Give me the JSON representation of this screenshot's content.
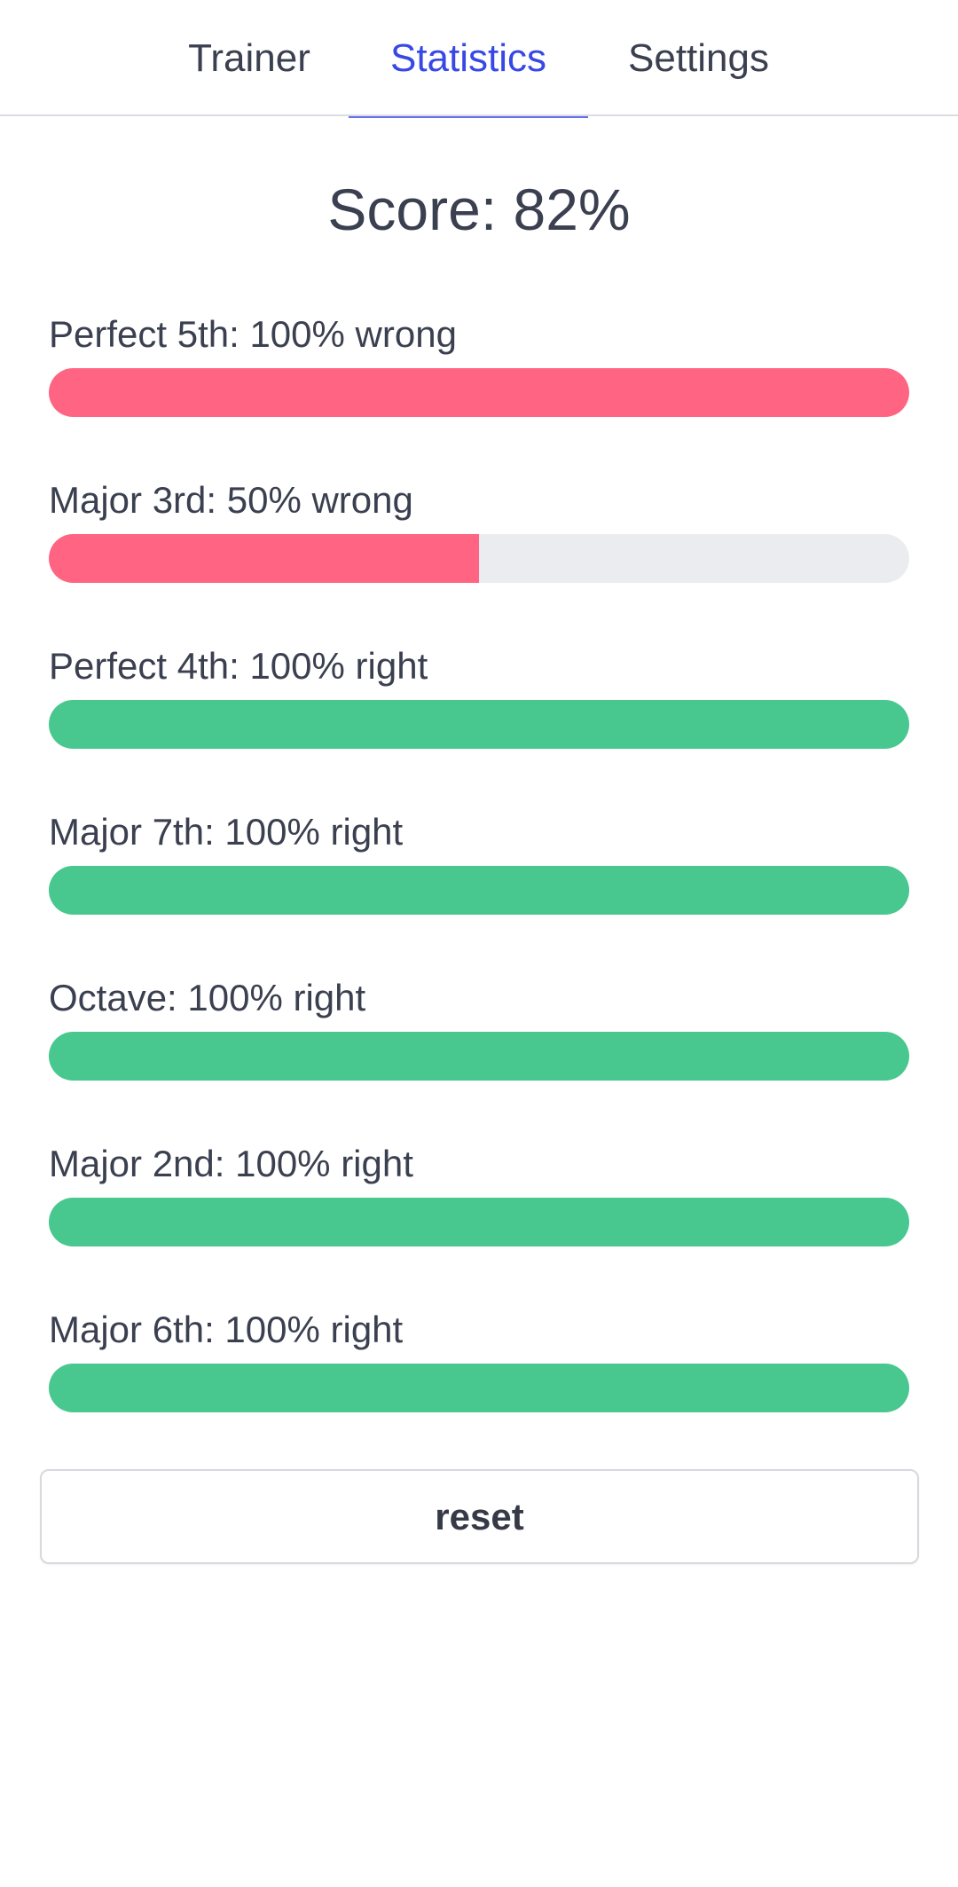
{
  "tabs": [
    {
      "label": "Trainer",
      "active": false
    },
    {
      "label": "Statistics",
      "active": true
    },
    {
      "label": "Settings",
      "active": false
    }
  ],
  "score": {
    "text": "Score: 82%"
  },
  "stats": [
    {
      "label": "Perfect 5th: 100% wrong",
      "result": "wrong",
      "percent": 100
    },
    {
      "label": "Major 3rd: 50% wrong",
      "result": "wrong",
      "percent": 50
    },
    {
      "label": "Perfect 4th: 100% right",
      "result": "right",
      "percent": 100
    },
    {
      "label": "Major 7th: 100% right",
      "result": "right",
      "percent": 100
    },
    {
      "label": "Octave: 100% right",
      "result": "right",
      "percent": 100
    },
    {
      "label": "Major 2nd: 100% right",
      "result": "right",
      "percent": 100
    },
    {
      "label": "Major 6th: 100% right",
      "result": "right",
      "percent": 100
    }
  ],
  "actions": {
    "reset_label": "reset"
  },
  "colors": {
    "accent": "#3748e6",
    "wrong": "#ff6582",
    "right": "#48c78e",
    "track": "#ebecef",
    "text": "#3b4050"
  }
}
